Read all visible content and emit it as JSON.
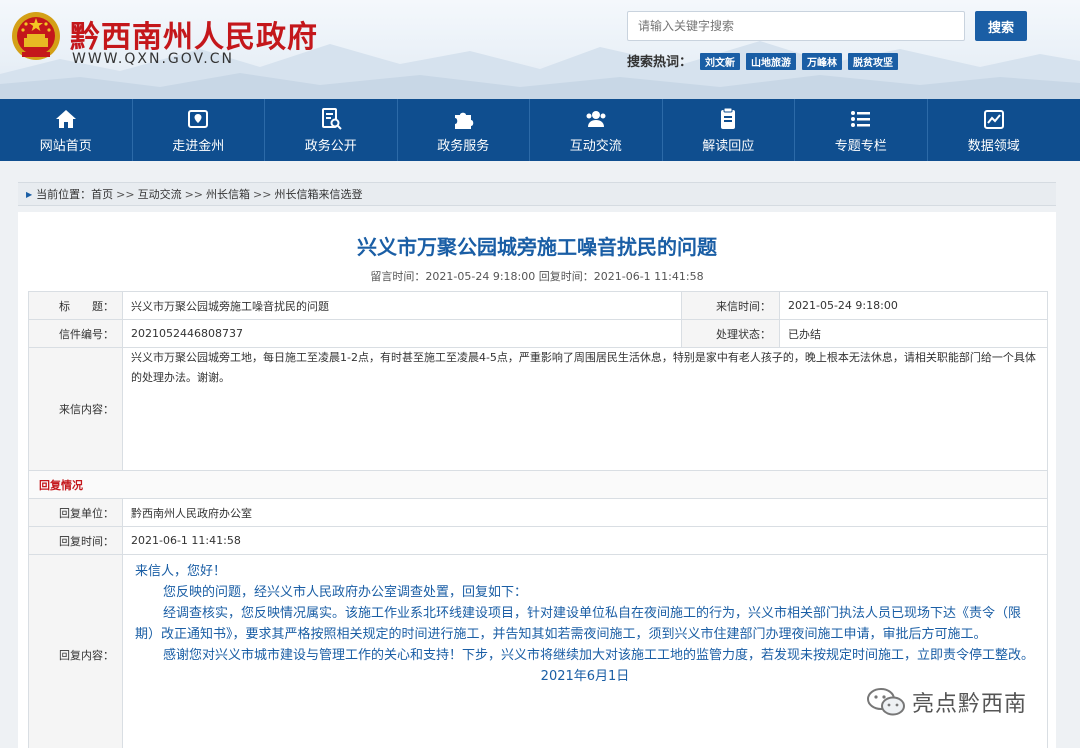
{
  "header": {
    "site_title": "黔西南州人民政府",
    "site_url": "WWW.QXN.GOV.CN",
    "search_placeholder": "请输入关键字搜索",
    "search_button": "搜索",
    "hot_label": "搜索热词：",
    "hot_tags": [
      "刘文新",
      "山地旅游",
      "万峰林",
      "脱贫攻坚"
    ]
  },
  "nav": [
    {
      "label": "网站首页",
      "icon": "home-icon"
    },
    {
      "label": "走进金州",
      "icon": "map-pin-icon"
    },
    {
      "label": "政务公开",
      "icon": "document-search-icon"
    },
    {
      "label": "政务服务",
      "icon": "puzzle-icon"
    },
    {
      "label": "互动交流",
      "icon": "users-icon"
    },
    {
      "label": "解读回应",
      "icon": "clipboard-icon"
    },
    {
      "label": "专题专栏",
      "icon": "list-icon"
    },
    {
      "label": "数据领域",
      "icon": "chart-icon"
    }
  ],
  "breadcrumb": {
    "prefix": "当前位置：",
    "items": [
      "首页",
      "互动交流",
      "州长信箱",
      "州长信箱来信选登"
    ],
    "sep": ">>"
  },
  "article": {
    "title": "兴义市万聚公园城旁施工噪音扰民的问题",
    "meta": "留言时间：2021-05-24 9:18:00 回复时间：2021-06-1 11:41:58"
  },
  "letter": {
    "title_label": "标　　题：",
    "title_value": "兴义市万聚公园城旁施工噪音扰民的问题",
    "date_label": "来信时间：",
    "date_value": "2021-05-24 9:18:00",
    "number_label": "信件编号：",
    "number_value": "2021052446808737",
    "status_label": "处理状态：",
    "status_value": "已办结",
    "content_label": "来信内容：",
    "content_value": "兴义市万聚公园城旁工地，每日施工至凌晨1-2点，有时甚至施工至凌晨4-5点，严重影响了周围居民生活休息，特别是家中有老人孩子的，晚上根本无法休息，请相关职能部门给一个具体的处理办法。谢谢。"
  },
  "reply": {
    "section_title": "回复情况",
    "unit_label": "回复单位：",
    "unit_value": "黔西南州人民政府办公室",
    "time_label": "回复时间：",
    "time_value": "2021-06-1 11:41:58",
    "content_label": "回复内容：",
    "greeting": "来信人，您好！",
    "p1": "您反映的问题，经兴义市人民政府办公室调查处置，回复如下：",
    "p2": "经调查核实，您反映情况属实。该施工作业系北环线建设项目，针对建设单位私自在夜间施工的行为，兴义市相关部门执法人员已现场下达《责令（限期）改正通知书》，要求其严格按照相关规定的时间进行施工，并告知其如若需夜间施工，须到兴义市住建部门办理夜间施工申请，审批后方可施工。",
    "p3": "感谢您对兴义市城市建设与管理工作的关心和支持！下步，兴义市将继续加大对该施工工地的监管力度，若发现未按规定时间施工，立即责令停工整改。",
    "date": "2021年6月1日"
  },
  "watermark": {
    "text": "亮点黔西南",
    "icon": "wechat-icon"
  },
  "colors": {
    "brand_red": "#c4171b",
    "nav_blue": "#0f4e8f",
    "accent_blue": "#1a5ea5"
  }
}
